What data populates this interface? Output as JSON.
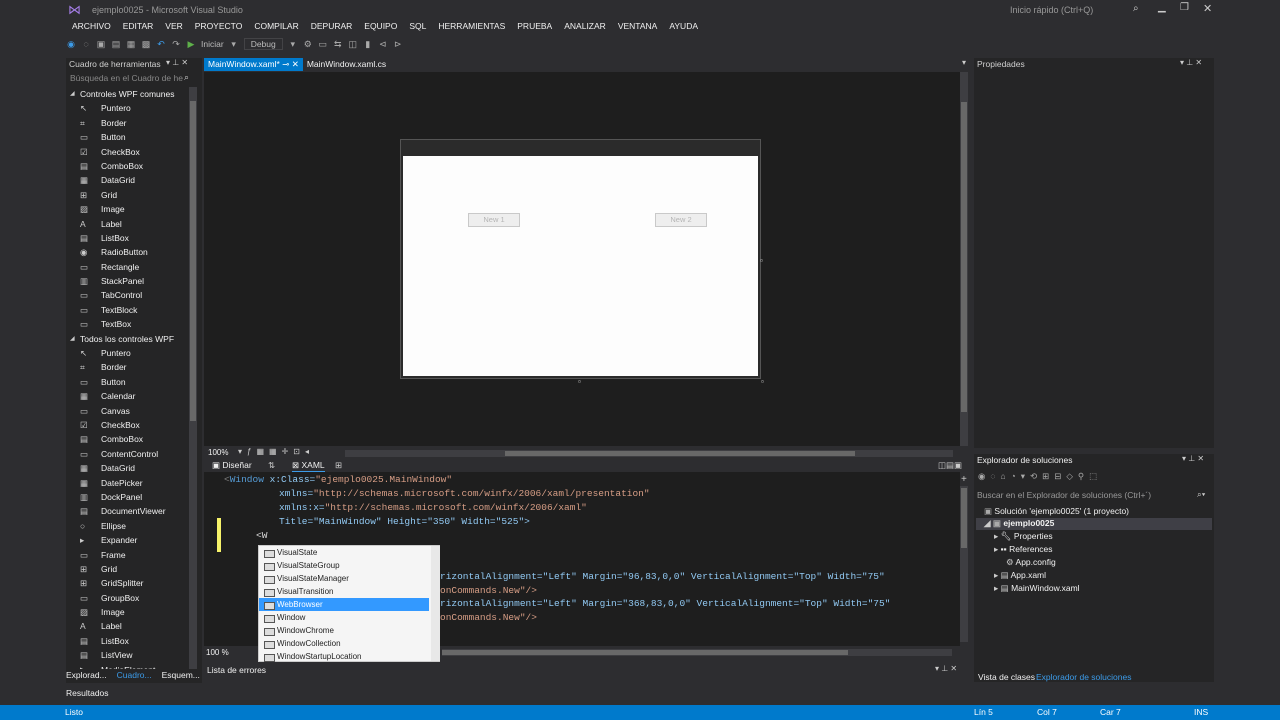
{
  "window": {
    "title": "ejemplo0025 - Microsoft Visual Studio",
    "quick_launch": "Inicio rápido (Ctrl+Q)"
  },
  "menu": [
    "ARCHIVO",
    "EDITAR",
    "VER",
    "PROYECTO",
    "COMPILAR",
    "DEPURAR",
    "EQUIPO",
    "SQL",
    "HERRAMIENTAS",
    "PRUEBA",
    "ANALIZAR",
    "VENTANA",
    "AYUDA"
  ],
  "toolbar": {
    "start_label": "Iniciar",
    "config": "Debug"
  },
  "toolbox": {
    "title": "Cuadro de herramientas",
    "search_placeholder": "Búsqueda en el Cuadro de he",
    "group1": "Controles WPF comunes",
    "common": [
      "Puntero",
      "Border",
      "Button",
      "CheckBox",
      "ComboBox",
      "DataGrid",
      "Grid",
      "Image",
      "Label",
      "ListBox",
      "RadioButton",
      "Rectangle",
      "StackPanel",
      "TabControl",
      "TextBlock",
      "TextBox"
    ],
    "group2": "Todos los controles WPF",
    "all": [
      "Puntero",
      "Border",
      "Button",
      "Calendar",
      "Canvas",
      "CheckBox",
      "ComboBox",
      "ContentControl",
      "DataGrid",
      "DatePicker",
      "DockPanel",
      "DocumentViewer",
      "Ellipse",
      "Expander",
      "Frame",
      "Grid",
      "GridSplitter",
      "GroupBox",
      "Image",
      "Label",
      "ListBox",
      "ListView",
      "MediaElement"
    ]
  },
  "tabs": [
    {
      "label": "MainWindow.xaml*",
      "active": true
    },
    {
      "label": "MainWindow.xaml.cs",
      "active": false
    }
  ],
  "designer": {
    "button1": "New 1",
    "button2": "New 2",
    "zoom": "100%"
  },
  "split": {
    "design_tab": "Diseñar",
    "xaml_tab": "XAML"
  },
  "code": {
    "l1_tag": "Window",
    "l1_attr": "x:Class=",
    "l1_val": "\"ejemplo0025.MainWindow\"",
    "l2_attr": "xmlns=",
    "l2_val": "\"http://schemas.microsoft.com/winfx/2006/xaml/presentation\"",
    "l3_attr": "xmlns:x=",
    "l3_val": "\"http://schemas.microsoft.com/winfx/2006/xaml\"",
    "l4": "Title=\"MainWindow\" Height=\"350\" Width=\"525\">",
    "l5": "<W",
    "l6": "rizontalAlignment=\"Left\" Margin=\"96,83,0,0\" VerticalAlignment=\"Top\" Width=\"75\"",
    "l7": "onCommands.New\"/>",
    "l8": "rizontalAlignment=\"Left\" Margin=\"368,83,0,0\" VerticalAlignment=\"Top\" Width=\"75\"",
    "l9": "onCommands.New\"/>",
    "zoom": "100 %"
  },
  "autocomplete": [
    "VisualState",
    "VisualStateGroup",
    "VisualStateManager",
    "VisualTransition",
    "WebBrowser",
    "Window",
    "WindowChrome",
    "WindowCollection",
    "WindowStartupLocation"
  ],
  "autocomplete_selected": "WebBrowser",
  "errors": {
    "title": "Lista de errores"
  },
  "properties": {
    "title": "Propiedades"
  },
  "solution": {
    "title": "Explorador de soluciones",
    "search": "Buscar en el Explorador de soluciones (Ctrl+´)",
    "solution_node": "Solución 'ejemplo0025' (1 proyecto)",
    "project": "ejemplo0025",
    "items": [
      "Properties",
      "References",
      "App.config",
      "App.xaml",
      "MainWindow.xaml"
    ]
  },
  "bottom_tabs": {
    "explorer": "Explorad...",
    "toolbox": "Cuadro...",
    "outline": "Esquem...",
    "class_view": "Vista de clases",
    "sol_explorer": "Explorador de soluciones",
    "results": "Resultados"
  },
  "status": {
    "ready": "Listo",
    "line": "Lín 5",
    "col": "Col 7",
    "char": "Car 7",
    "mode": "INS"
  },
  "colors": {
    "accent": "#007acc",
    "background": "#2d2d30",
    "editor": "#1e1e1e"
  }
}
